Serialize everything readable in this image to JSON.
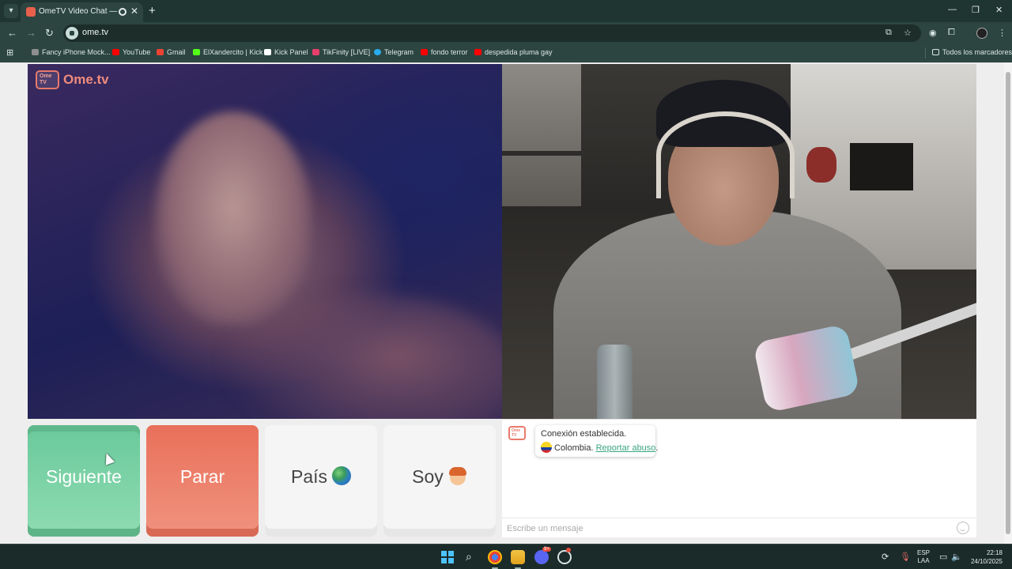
{
  "browser": {
    "tab_title": "OmeTV Video Chat — Ome",
    "new_tab_icon": "plus-icon",
    "url": "ome.tv",
    "bookmarks": [
      {
        "label": "Fancy iPhone Mock...",
        "icon_color": "#8e8e8e"
      },
      {
        "label": "YouTube",
        "icon_color": "#ff0000"
      },
      {
        "label": "Gmail",
        "icon_color": "#ea4335"
      },
      {
        "label": "ElXandercito | Kick",
        "icon_color": "#53fc18"
      },
      {
        "label": "Kick Panel",
        "icon_color": "#ffffff"
      },
      {
        "label": "TikFinity [LIVE]",
        "icon_color": "#e83e6c"
      },
      {
        "label": "Telegram",
        "icon_color": "#2aabee"
      },
      {
        "label": "fondo terror",
        "icon_color": "#ff0000"
      },
      {
        "label": "despedida pluma gay",
        "icon_color": "#ff0000"
      }
    ],
    "all_bookmarks_label": "Todos los marcadores"
  },
  "page": {
    "logo_text": "Ome.tv",
    "logo_badge": "Ome TV",
    "buttons": {
      "next": "Siguiente",
      "stop": "Parar",
      "country": "País",
      "gender": "Soy"
    },
    "chat": {
      "status_message": "Conexión establecida.",
      "country": "Colombia.",
      "report_link": "Reportar abuso",
      "report_suffix": ".",
      "input_placeholder": "Escribe un mensaje"
    }
  },
  "taskbar": {
    "lang_line1": "ESP",
    "lang_line2": "LAA",
    "time": "22:18",
    "date": "24/10/2025",
    "discord_badge": "9+"
  },
  "colors": {
    "next_button": "#69c99a",
    "stop_button": "#e9705a",
    "brand": "#f08b7c",
    "link": "#3aa583"
  }
}
